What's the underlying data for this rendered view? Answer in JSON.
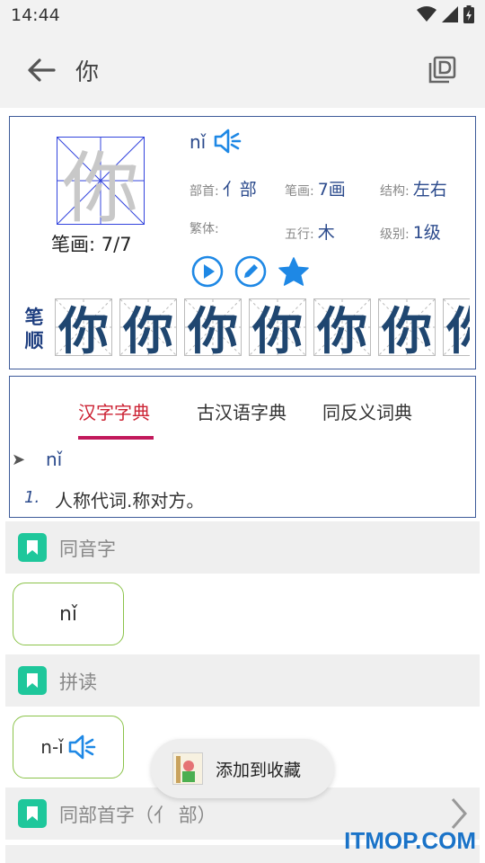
{
  "status": {
    "time": "14:44"
  },
  "header": {
    "title": "你"
  },
  "character": {
    "glyph": "你",
    "stroke_count_label": "笔画:",
    "stroke_count_value": "7/7",
    "pinyin": "nǐ",
    "radical_label": "部首:",
    "radical_value": "亻部",
    "strokes_label": "笔画:",
    "strokes_value": "7画",
    "structure_label": "结构:",
    "structure_value": "左右",
    "traditional_label": "繁体:",
    "traditional_value": "",
    "wuxing_label": "五行:",
    "wuxing_value": "木",
    "level_label": "级别:",
    "level_value": "1级",
    "stroke_order_label": "笔顺",
    "stroke_frames": [
      "你",
      "你",
      "你",
      "你",
      "你",
      "你",
      "你"
    ]
  },
  "tabs": [
    {
      "label": "汉字字典",
      "active": true
    },
    {
      "label": "古汉语字典",
      "active": false
    },
    {
      "label": "同反义词典",
      "active": false
    }
  ],
  "definition": {
    "pinyin": "nǐ",
    "number": "1.",
    "text": "人称代词.称对方。"
  },
  "sections": {
    "homophones": {
      "title": "同音字",
      "chip": "nǐ"
    },
    "spelling": {
      "title": "拼读",
      "chip": "n-ǐ"
    },
    "same_radical": {
      "title": "同部首字（亻 部）"
    }
  },
  "toast": {
    "text": "添加到收藏"
  },
  "watermark": "ITMOP.COM",
  "colors": {
    "accent_red": "#cc2233",
    "tab_underline": "#c2185b",
    "badge_green": "#1ec79b",
    "link_blue": "#2b4a8c",
    "icon_blue": "#1e88e5",
    "pill_border": "#8bc34a"
  }
}
